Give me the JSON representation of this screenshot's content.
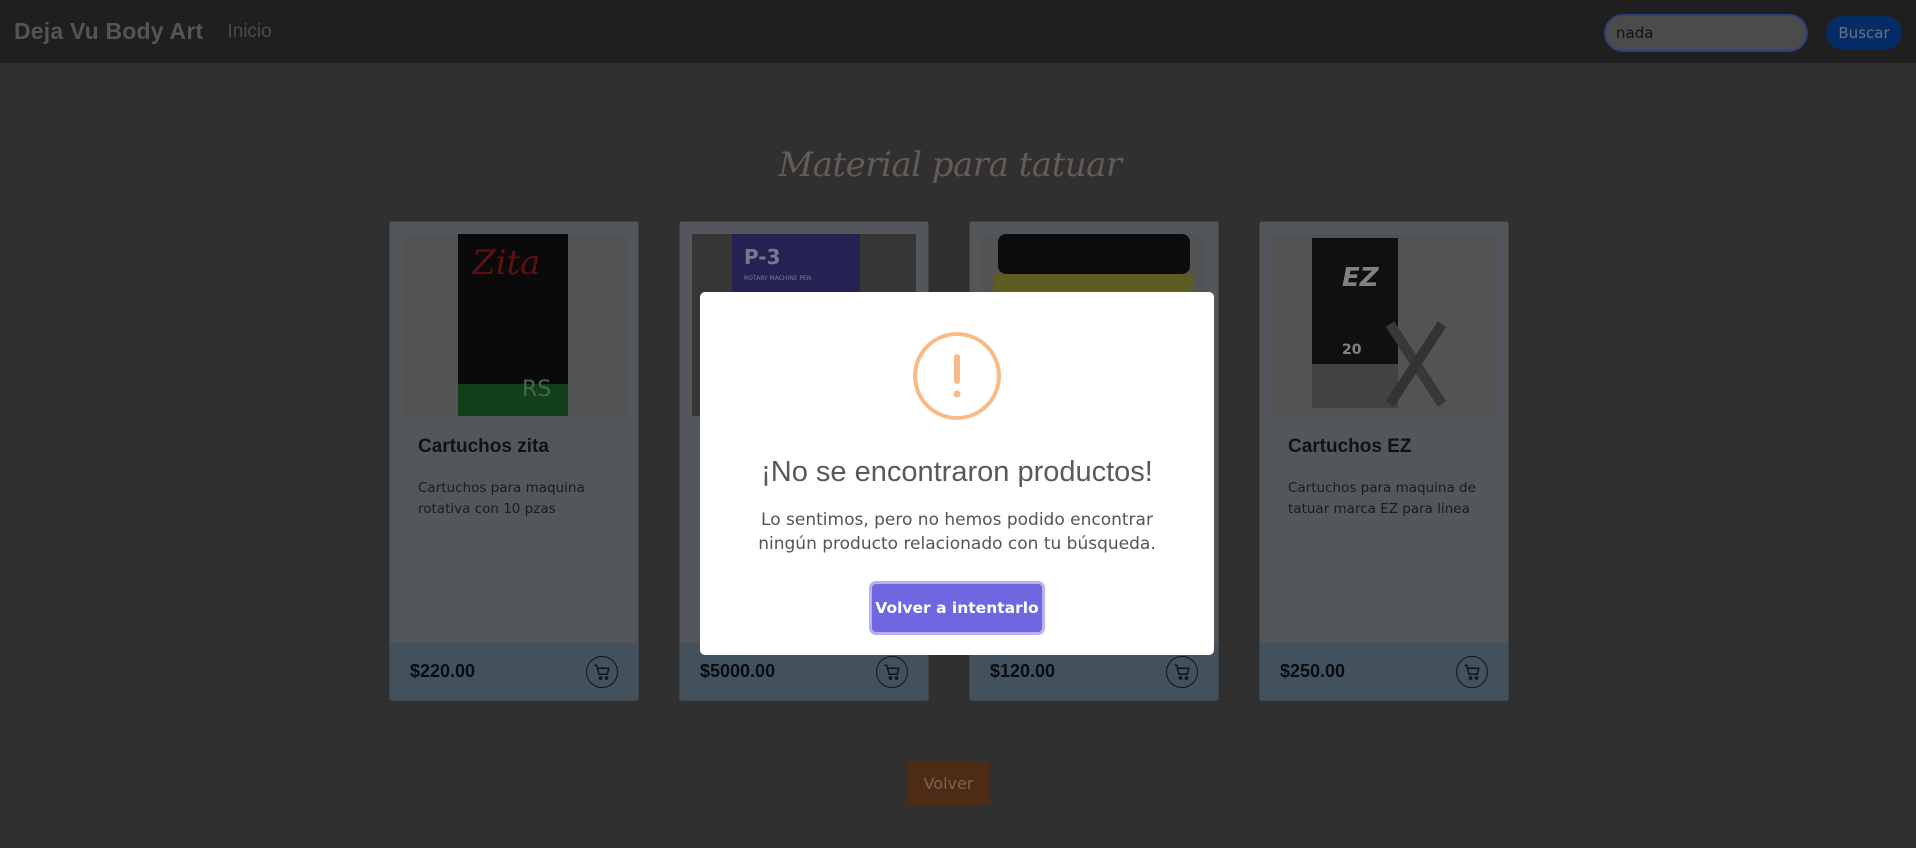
{
  "navbar": {
    "brand": "Deja Vu Body Art",
    "nav_link": "Inicio",
    "search_value": "nada",
    "search_button": "Buscar"
  },
  "section": {
    "title": "Material para tatuar"
  },
  "products": [
    {
      "title": "Cartuchos zita",
      "description": "Cartuchos para maquina rotativa con 10 pzas",
      "price": "$220.00",
      "image_label": "Zita",
      "image_sub": "RS"
    },
    {
      "title": "",
      "description": "",
      "price": "$5000.00",
      "image_label": "P-3",
      "image_sub": "ROTARY MACHINE PEN"
    },
    {
      "title": "",
      "description": "",
      "price": "$120.00",
      "image_label": "",
      "image_sub": ""
    },
    {
      "title": "Cartuchos EZ",
      "description": "Cartuchos para maquina de tatuar marca EZ para linea",
      "price": "$250.00",
      "image_label": "EZ",
      "image_sub": "20"
    }
  ],
  "back_button": "Volver",
  "modal": {
    "icon": "!",
    "title": "¡No se encontraron productos!",
    "text": "Lo sentimos, pero no hemos podido encontrar ningún producto relacionado con tu búsqueda.",
    "button": "Volver a intentarlo"
  },
  "colors": {
    "modal_button": "#7066e0",
    "warning_icon": "#f8bb86",
    "back_button": "#804824",
    "search_button": "#0a4aa8"
  },
  "icons": {
    "cart": "cart-icon",
    "warning": "exclamation-icon"
  }
}
